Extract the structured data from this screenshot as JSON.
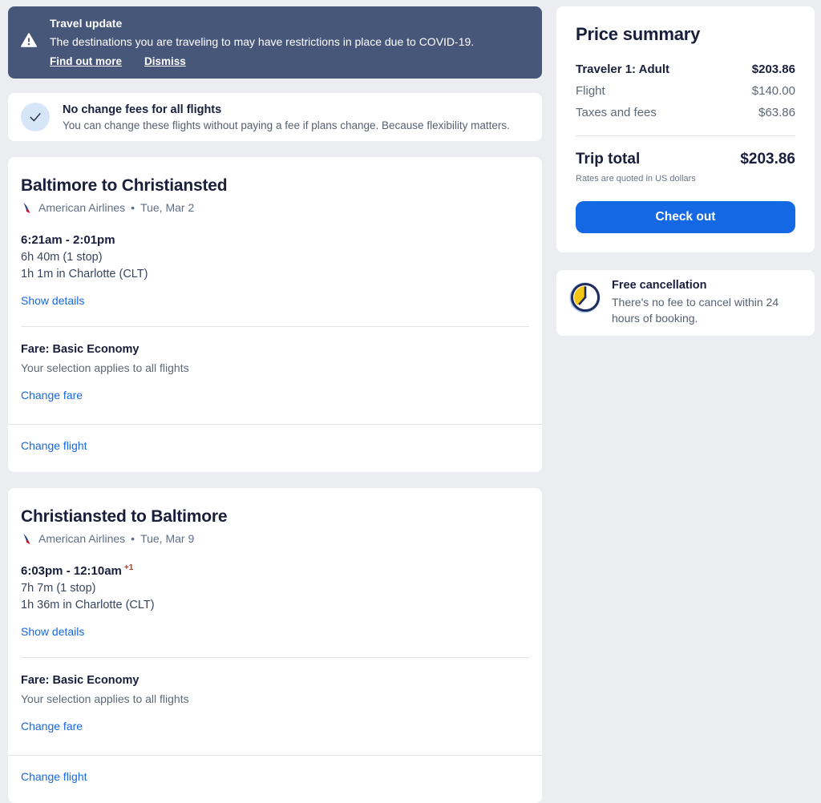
{
  "banner": {
    "title": "Travel update",
    "body": "The destinations you are traveling to may have restrictions in place due to COVID-19.",
    "find_out_more": "Find out more",
    "dismiss": "Dismiss"
  },
  "notice": {
    "title": "No change fees for all flights",
    "body": "You can change these flights without paying a fee if plans change. Because flexibility matters."
  },
  "flights": [
    {
      "title": "Baltimore to Christiansted",
      "airline": "American Airlines",
      "separator": "•",
      "date": "Tue, Mar 2",
      "times": "6:21am - 2:01pm",
      "next_day": "",
      "duration": "6h 40m (1 stop)",
      "layover": "1h 1m in Charlotte (CLT)",
      "show_details": "Show details",
      "fare_label": "Fare: Basic Economy",
      "fare_note": "Your selection applies to all flights",
      "change_fare": "Change fare",
      "change_flight": "Change flight"
    },
    {
      "title": "Christiansted to Baltimore",
      "airline": "American Airlines",
      "separator": "•",
      "date": "Tue, Mar 9",
      "times": "6:03pm - 12:10am",
      "next_day": "+1",
      "duration": "7h 7m (1 stop)",
      "layover": "1h 36m in Charlotte (CLT)",
      "show_details": "Show details",
      "fare_label": "Fare: Basic Economy",
      "fare_note": "Your selection applies to all flights",
      "change_fare": "Change fare",
      "change_flight": "Change flight"
    }
  ],
  "price_summary": {
    "title": "Price summary",
    "rows": [
      {
        "label": "Traveler 1: Adult",
        "value": "$203.86"
      },
      {
        "label": "Flight",
        "value": "$140.00"
      },
      {
        "label": "Taxes and fees",
        "value": "$63.86"
      }
    ],
    "trip_total_label": "Trip total",
    "trip_total_value": "$203.86",
    "rates_note": "Rates are quoted in US dollars",
    "checkout_label": "Check out"
  },
  "cancellation": {
    "title": "Free cancellation",
    "body": "There's no fee to cancel within 24 hours of booking."
  },
  "colors": {
    "banner_bg": "#47577A",
    "button_blue": "#1568E3",
    "link_blue": "#1668E1",
    "heading_navy": "#191E3B",
    "next_day_red": "#C13515",
    "page_bg": "#EBEDF0"
  }
}
